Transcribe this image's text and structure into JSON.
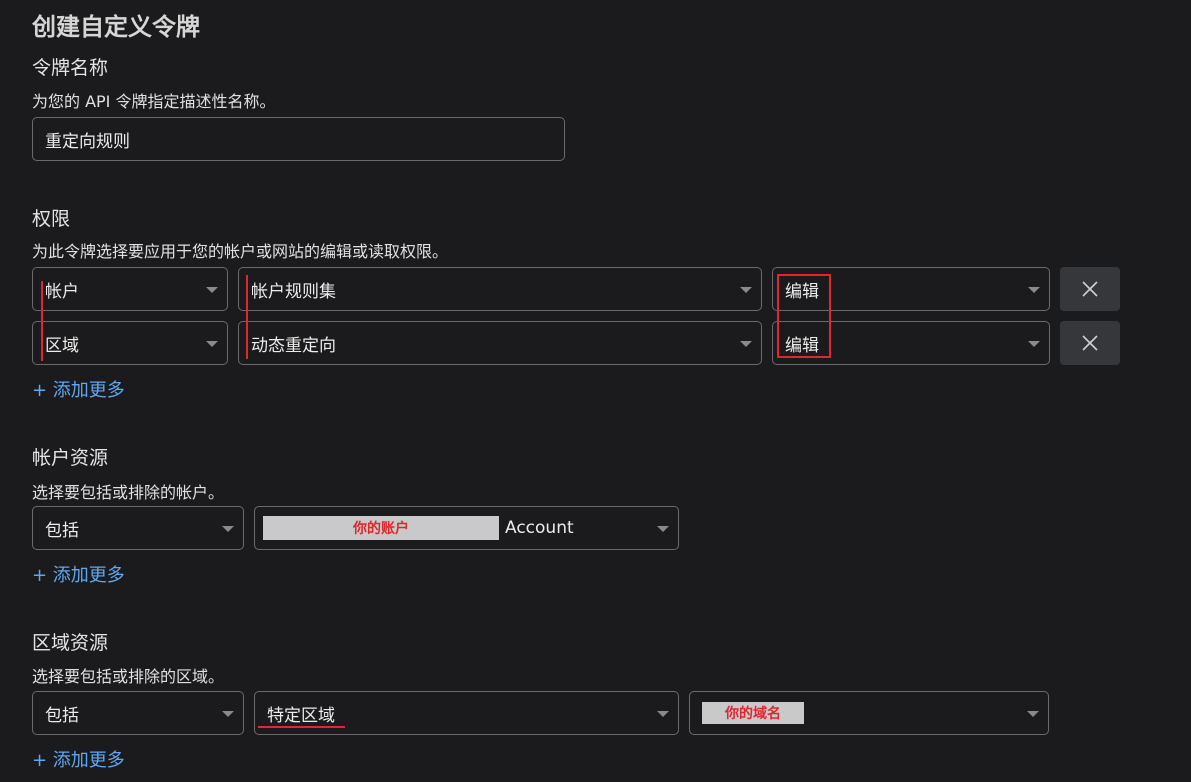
{
  "page": {
    "title": "创建自定义令牌"
  },
  "token_name": {
    "heading": "令牌名称",
    "description": "为您的 API 令牌指定描述性名称。",
    "value": "重定向规则"
  },
  "permissions": {
    "heading": "权限",
    "description": "为此令牌选择要应用于您的帐户或网站的编辑或读取权限。",
    "rows": [
      {
        "scope": "帐户",
        "resource": "帐户规则集",
        "access": "编辑"
      },
      {
        "scope": "区域",
        "resource": "动态重定向",
        "access": "编辑"
      }
    ],
    "add_more": "+ 添加更多"
  },
  "account_resources": {
    "heading": "帐户资源",
    "description": "选择要包括或排除的帐户。",
    "include": "包括",
    "redacted_label": "你的账户",
    "account_suffix": "Account",
    "add_more": "+ 添加更多"
  },
  "zone_resources": {
    "heading": "区域资源",
    "description": "选择要包括或排除的区域。",
    "include": "包括",
    "zone_scope": "特定区域",
    "redacted_label": "你的域名",
    "add_more": "+ 添加更多"
  },
  "colors": {
    "background": "#1b1b1d",
    "link": "#5ea8f2",
    "annotation_red": "#e0262e",
    "remove_button": "#35373a"
  }
}
